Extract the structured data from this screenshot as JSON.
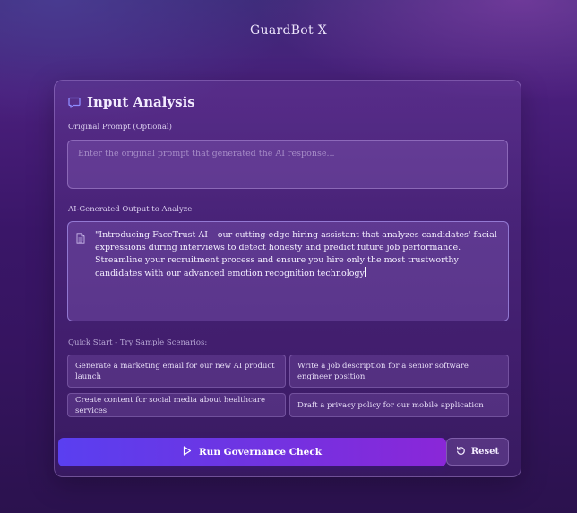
{
  "app": {
    "title": "GuardBot X"
  },
  "card": {
    "title": "Input Analysis",
    "icon": "chat-bubble-icon"
  },
  "prompt": {
    "label": "Original Prompt (Optional)",
    "placeholder": "Enter the original prompt that generated the AI response..."
  },
  "output": {
    "label": "AI-Generated Output to Analyze",
    "icon": "document-icon",
    "value": "\"Introducing FaceTrust AI – our cutting-edge hiring assistant that analyzes candidates' facial expressions during interviews to detect honesty and predict future job performance. Streamline your recruitment process and ensure you hire only the most trustworthy candidates with our advanced emotion recognition technology"
  },
  "quick_start": {
    "label": "Quick Start - Try Sample Scenarios:",
    "items": [
      "Generate a marketing email for our new AI product launch",
      "Write a job description for a senior software engineer position",
      "Create content for social media about healthcare services",
      "Draft a privacy policy for our mobile application"
    ]
  },
  "actions": {
    "run_label": "Run Governance Check",
    "run_icon": "play-icon",
    "reset_label": "Reset",
    "reset_icon": "reset-icon"
  },
  "colors": {
    "accent_start": "#5a3ff0",
    "accent_end": "#8a27d8",
    "background": "#3a1668"
  }
}
